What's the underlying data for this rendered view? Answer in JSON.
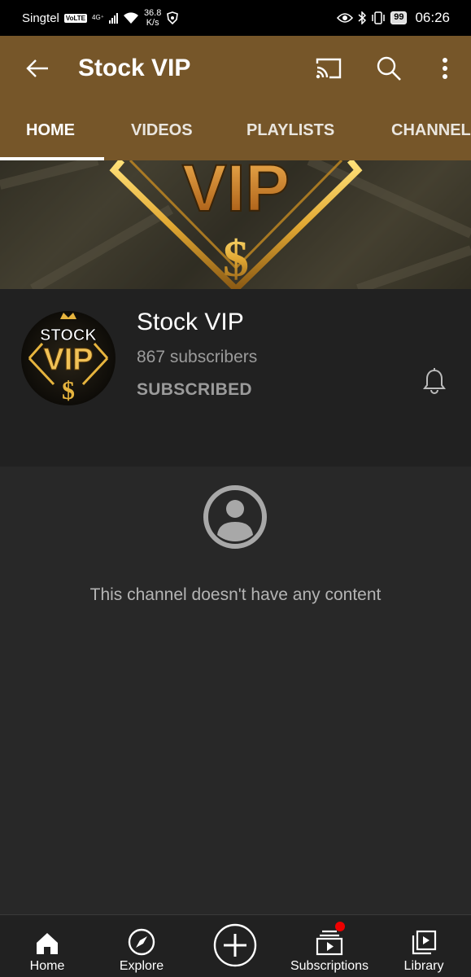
{
  "status_bar": {
    "carrier": "Singtel",
    "volte": "VoLTE",
    "network": "4G⁺",
    "speed_value": "36.8",
    "speed_unit": "K/s",
    "battery": "99",
    "time": "06:26"
  },
  "app_bar": {
    "title": "Stock VIP",
    "icons": [
      "back-arrow-icon",
      "cast-icon",
      "search-icon",
      "more-vert-icon"
    ]
  },
  "tabs": [
    {
      "label": "HOME",
      "active": true
    },
    {
      "label": "VIDEOS",
      "active": false
    },
    {
      "label": "PLAYLISTS",
      "active": false
    },
    {
      "label": "CHANNEL",
      "active": false
    }
  ],
  "banner": {
    "logo_text": "VIP",
    "symbol": "$"
  },
  "channel": {
    "name": "Stock VIP",
    "subscribers": "867 subscribers",
    "subscribe_status": "SUBSCRIBED",
    "avatar_line1": "STOCK",
    "avatar_line2": "VIP",
    "avatar_symbol": "$"
  },
  "content": {
    "empty_message": "This channel doesn't have any content"
  },
  "bottom_nav": [
    {
      "label": "Home",
      "icon": "home-icon"
    },
    {
      "label": "Explore",
      "icon": "compass-icon"
    },
    {
      "label": "",
      "icon": "create-plus-icon"
    },
    {
      "label": "Subscriptions",
      "icon": "subscriptions-icon",
      "badge": true
    },
    {
      "label": "Library",
      "icon": "library-icon"
    }
  ],
  "colors": {
    "app_bar": "#765629",
    "channel_bg": "#212121",
    "content_bg": "#282828",
    "muted_text": "#9b9b9b",
    "badge": "#ee0000"
  }
}
